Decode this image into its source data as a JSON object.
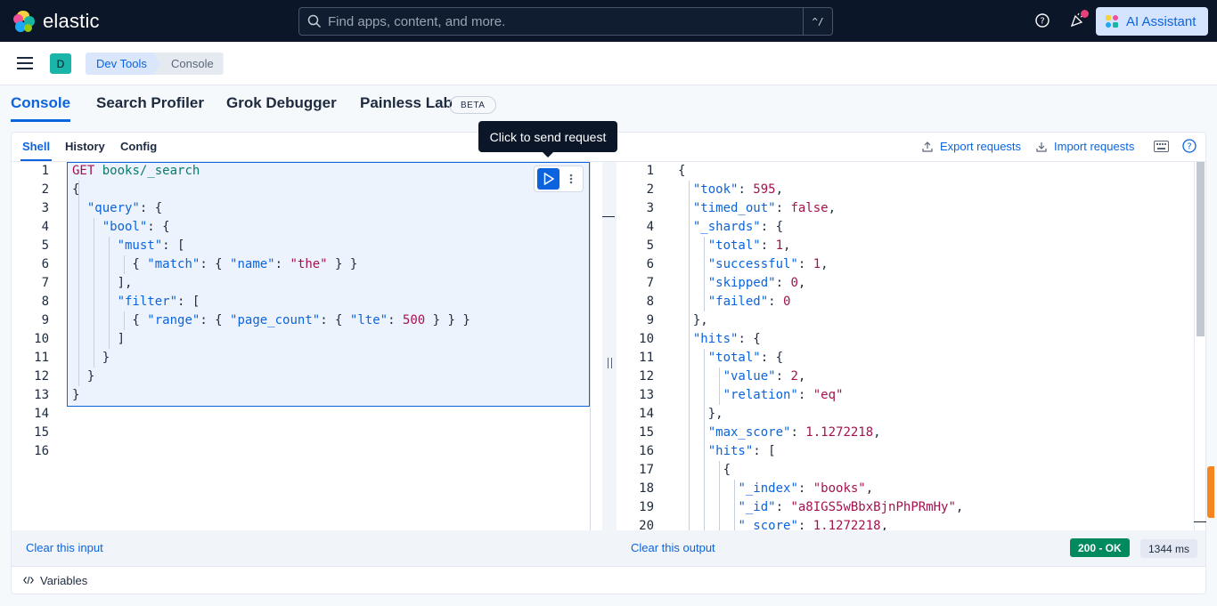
{
  "header": {
    "logo_text": "elastic",
    "search_placeholder": "Find apps, content, and more.",
    "search_shortcut": "^/",
    "ai_assistant_label": "AI Assistant"
  },
  "breadcrumbs": {
    "space_initial": "D",
    "items": [
      "Dev Tools",
      "Console"
    ]
  },
  "app_tabs": [
    {
      "label": "Console",
      "active": true
    },
    {
      "label": "Search Profiler",
      "active": false
    },
    {
      "label": "Grok Debugger",
      "active": false
    },
    {
      "label": "Painless Lab",
      "active": false
    }
  ],
  "beta_badge": "BETA",
  "console": {
    "tabs": [
      {
        "label": "Shell",
        "active": true
      },
      {
        "label": "History",
        "active": false
      },
      {
        "label": "Config",
        "active": false
      }
    ],
    "export_label": "Export requests",
    "import_label": "Import requests",
    "tooltip": "Click to send request",
    "clear_input": "Clear this input",
    "clear_output": "Clear this output",
    "status_code": "200 - OK",
    "elapsed": "1344 ms",
    "variables_label": "Variables"
  },
  "editor_lines": [
    "GET books/_search",
    "{",
    "  \"query\": {",
    "    \"bool\": {",
    "      \"must\": [",
    "        { \"match\": { \"name\": \"the\" } }",
    "      ],",
    "      \"filter\": [",
    "        { \"range\": { \"page_count\": { \"lte\": 500 } } }",
    "      ]",
    "    }",
    "  }",
    "}",
    "",
    "",
    ""
  ],
  "output_lines": [
    "{",
    "  \"took\": 595,",
    "  \"timed_out\": false,",
    "  \"_shards\": {",
    "    \"total\": 1,",
    "    \"successful\": 1,",
    "    \"skipped\": 0,",
    "    \"failed\": 0",
    "  },",
    "  \"hits\": {",
    "    \"total\": {",
    "      \"value\": 2,",
    "      \"relation\": \"eq\"",
    "    },",
    "    \"max_score\": 1.1272218,",
    "    \"hits\": [",
    "      {",
    "        \"_index\": \"books\",",
    "        \"_id\": \"a8IGS5wBbxBjnPhPRmHy\",",
    "        \"_score\": 1.1272218,"
  ],
  "colors": {
    "accent": "#0b64dd",
    "header_bg": "#0b1628",
    "status_ok": "#008a5e",
    "string": "#a4124d"
  }
}
